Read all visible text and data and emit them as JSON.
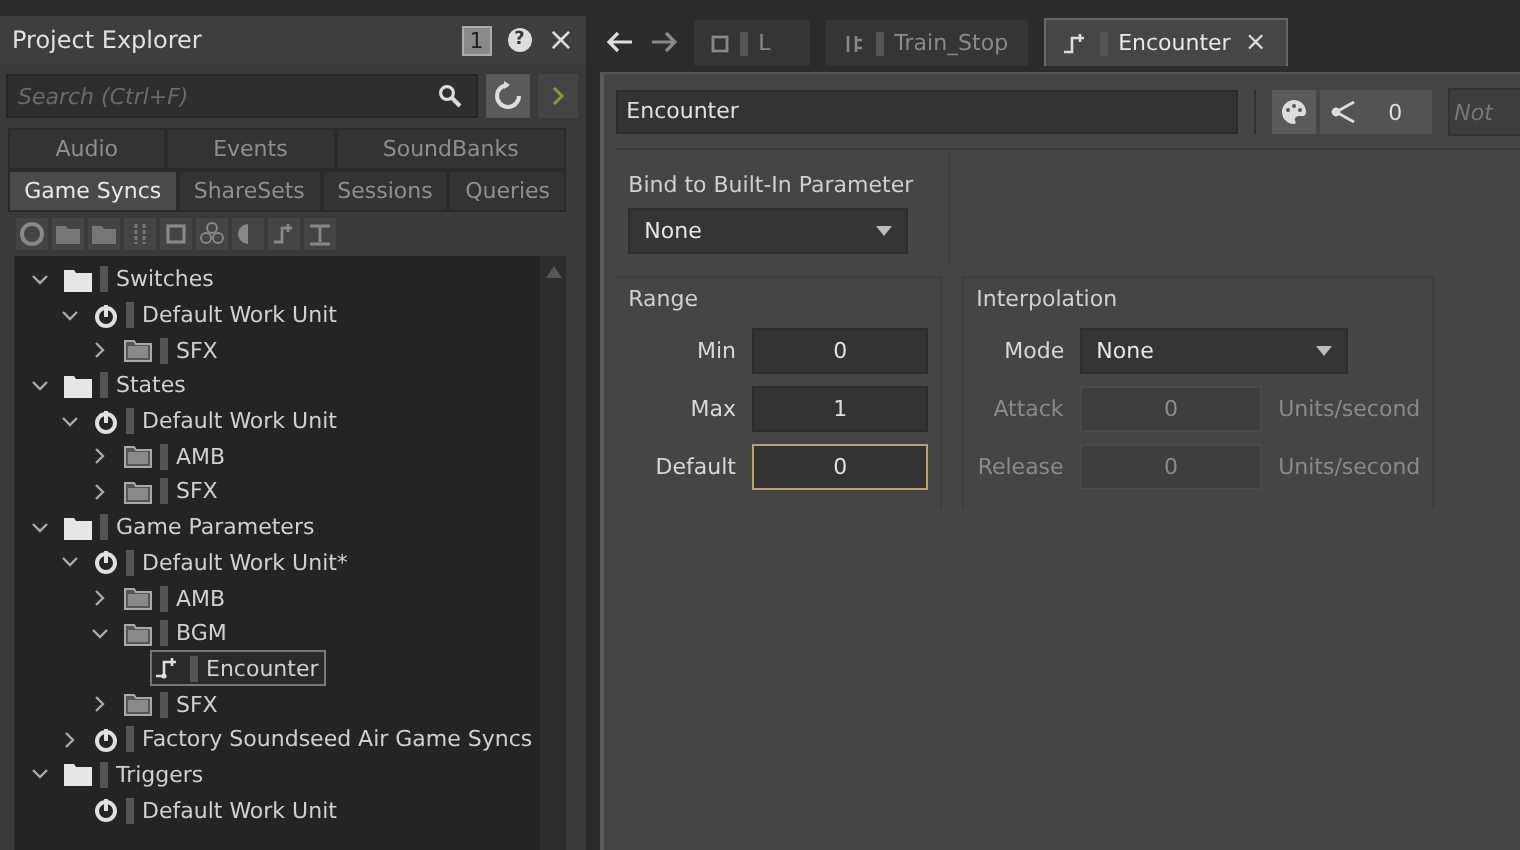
{
  "explorer": {
    "title": "Project Explorer",
    "badge": "1",
    "help": "?",
    "close": "×",
    "search": {
      "placeholder": "Search (Ctrl+F)"
    },
    "tab_rows": [
      [
        {
          "label": "Audio",
          "selected": false
        },
        {
          "label": "Events",
          "selected": false
        },
        {
          "label": "SoundBanks",
          "selected": false
        }
      ],
      [
        {
          "label": "Game Syncs",
          "selected": true
        },
        {
          "label": "ShareSets",
          "selected": false
        },
        {
          "label": "Sessions",
          "selected": false
        },
        {
          "label": "Queries",
          "selected": false
        }
      ]
    ],
    "tree": [
      {
        "label": "Switches",
        "kind": "folder",
        "expanded": true,
        "selected": false,
        "children": [
          {
            "label": "Default Work Unit",
            "kind": "workunit",
            "expanded": true,
            "selected": false,
            "children": [
              {
                "label": "SFX",
                "kind": "subfolder",
                "expanded": false,
                "selected": false
              }
            ]
          }
        ]
      },
      {
        "label": "States",
        "kind": "folder",
        "expanded": true,
        "selected": false,
        "children": [
          {
            "label": "Default Work Unit",
            "kind": "workunit",
            "expanded": true,
            "selected": false,
            "children": [
              {
                "label": "AMB",
                "kind": "subfolder",
                "expanded": false,
                "selected": false
              },
              {
                "label": "SFX",
                "kind": "subfolder",
                "expanded": false,
                "selected": false
              }
            ]
          }
        ]
      },
      {
        "label": "Game Parameters",
        "kind": "folder",
        "expanded": true,
        "selected": false,
        "children": [
          {
            "label": "Default Work Unit*",
            "kind": "workunit",
            "expanded": true,
            "selected": false,
            "children": [
              {
                "label": "AMB",
                "kind": "subfolder",
                "expanded": false,
                "selected": false
              },
              {
                "label": "BGM",
                "kind": "subfolder",
                "expanded": true,
                "selected": false,
                "children": [
                  {
                    "label": "Encounter",
                    "kind": "parameter",
                    "selected": true
                  }
                ]
              },
              {
                "label": "SFX",
                "kind": "subfolder",
                "expanded": false,
                "selected": false
              }
            ]
          },
          {
            "label": "Factory Soundseed Air Game Syncs",
            "kind": "workunit",
            "expanded": false,
            "selected": false
          }
        ]
      },
      {
        "label": "Triggers",
        "kind": "folder",
        "expanded": true,
        "selected": false,
        "children": [
          {
            "label": "Default Work Unit",
            "kind": "workunit",
            "selected": false
          }
        ]
      }
    ]
  },
  "editor": {
    "tabs": [
      {
        "label": "L",
        "kind": "sound",
        "selected": false,
        "closable": false
      },
      {
        "label": "Train_Stop",
        "kind": "blend",
        "selected": false,
        "closable": false
      },
      {
        "label": "Encounter",
        "kind": "parameter",
        "selected": true,
        "closable": true
      }
    ],
    "close": "×",
    "name": "Encounter",
    "share_count": "0",
    "notes": {
      "placeholder": "Not"
    },
    "bind": {
      "label": "Bind to Built-In Parameter",
      "value": "None"
    },
    "range": {
      "title": "Range",
      "fields": [
        {
          "label": "Min",
          "value": "0",
          "focused": false
        },
        {
          "label": "Max",
          "value": "1",
          "focused": false
        },
        {
          "label": "Default",
          "value": "0",
          "focused": true
        }
      ]
    },
    "interpolation": {
      "title": "Interpolation",
      "mode_label": "Mode",
      "mode": "None",
      "fields": [
        {
          "label": "Attack",
          "value": "0",
          "unit": "Units/second",
          "disabled": true
        },
        {
          "label": "Release",
          "value": "0",
          "unit": "Units/second",
          "disabled": true
        }
      ]
    }
  }
}
